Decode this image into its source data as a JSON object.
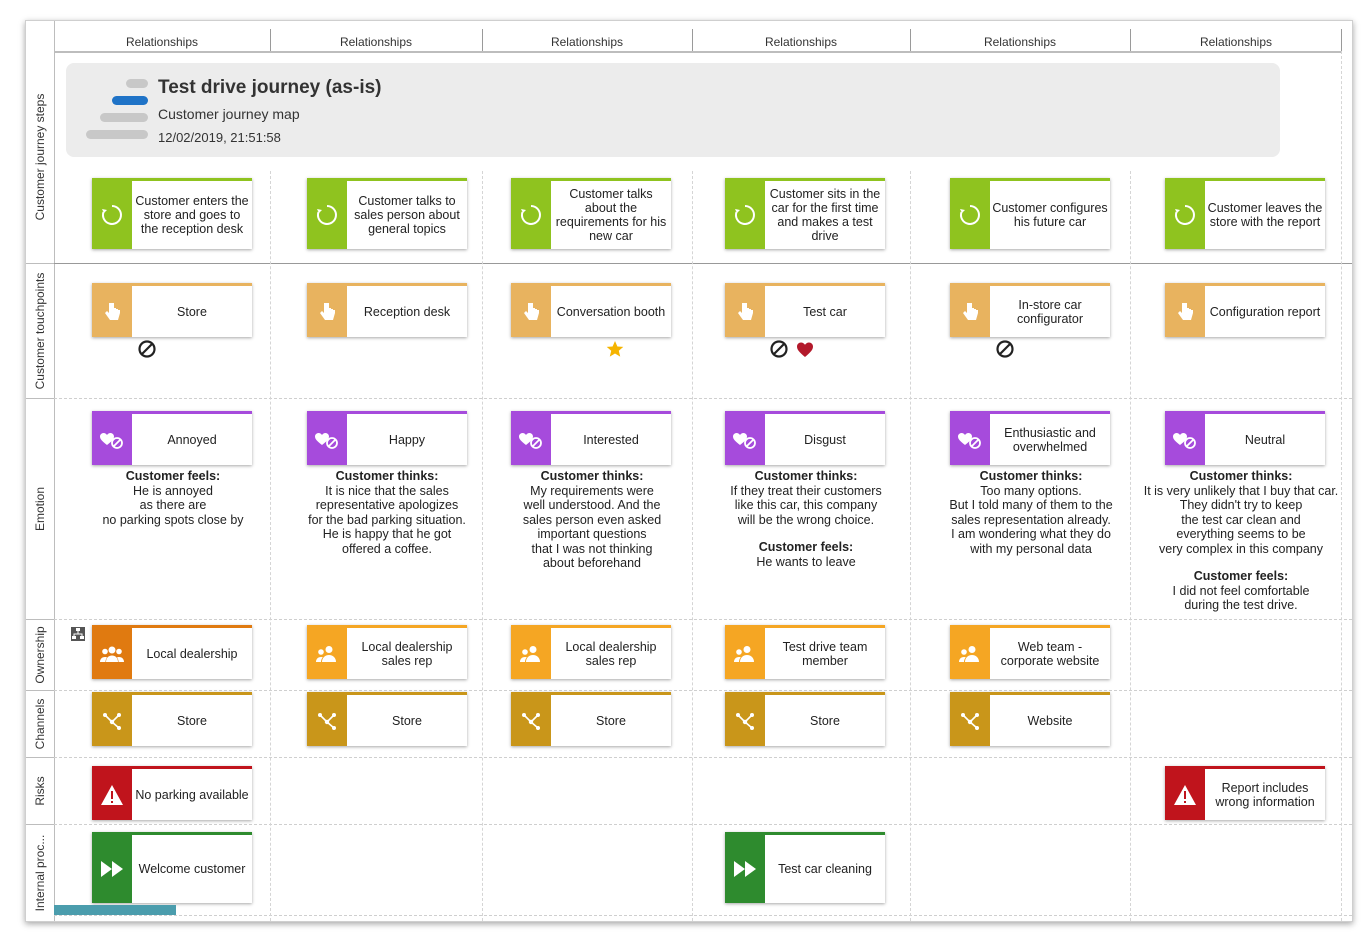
{
  "columns": [
    "Relationships",
    "Relationships",
    "Relationships",
    "Relationships",
    "Relationships",
    "Relationships"
  ],
  "rows": [
    "Customer journey steps",
    "Customer touchpoints",
    "Emotion",
    "Ownership",
    "Channels",
    "Risks",
    "Internal proc..."
  ],
  "header": {
    "title": "Test drive journey (as-is)",
    "subtitle": "Customer journey map",
    "date": "12/02/2019, 21:51:58"
  },
  "steps": [
    "Customer enters the store and goes to the reception desk",
    "Customer talks to sales person about general topics",
    "Customer talks about the requirements for his new car",
    "Customer sits in the car for the first time and makes a test drive",
    "Customer configures his future car",
    "Customer leaves the store with the report"
  ],
  "touchpoints": [
    "Store",
    "Reception desk",
    "Conversation booth",
    "Test car",
    "In-store car configurator",
    "Configuration report"
  ],
  "emotions": [
    "Annoyed",
    "Happy",
    "Interested",
    "Disgust",
    "Enthusiastic and overwhelmed",
    "Neutral"
  ],
  "emotion_texts": [
    [
      {
        "h": "Customer feels:",
        "t": [
          "He is annoyed",
          "as there are",
          "no parking spots close by"
        ]
      }
    ],
    [
      {
        "h": "Customer thinks:",
        "t": [
          "It is nice that the sales",
          "representative apologizes",
          "for the bad parking situation.",
          "He is happy that he got",
          "offered a coffee."
        ]
      }
    ],
    [
      {
        "h": "Customer thinks:",
        "t": [
          "My requirements were",
          "well understood. And the",
          "sales person even asked",
          "important questions",
          "that I was not thinking",
          "about beforehand"
        ]
      }
    ],
    [
      {
        "h": "Customer thinks:",
        "t": [
          "If they treat their customers",
          "like this car, this company",
          "will be the wrong choice."
        ]
      },
      {
        "h": "Customer feels:",
        "t": [
          "He wants to leave"
        ]
      }
    ],
    [
      {
        "h": "Customer thinks:",
        "t": [
          "Too many options.",
          "But I told many of them to the",
          "sales representation already.",
          "I am wondering what they do",
          "with my personal data"
        ]
      }
    ],
    [
      {
        "h": "Customer thinks:",
        "t": [
          "It is very unlikely that I buy that car.",
          "They didn't try to keep",
          "the test car clean and",
          "everything seems to be",
          "very complex in this company"
        ]
      },
      {
        "h": "Customer feels:",
        "t": [
          "I did not feel comfortable",
          "during the test drive."
        ]
      }
    ]
  ],
  "ownership": [
    "Local dealership",
    "Local dealership sales rep",
    "Local dealership sales rep",
    "Test drive team member",
    "Web team - corporate website"
  ],
  "channels": [
    "Store",
    "Store",
    "Store",
    "Store",
    "Website"
  ],
  "risks": {
    "col0": "No parking available",
    "col5": "Report includes wrong information"
  },
  "processes": {
    "col0": "Welcome customer",
    "col3": "Test car cleaning"
  },
  "colors": {
    "step": "#8fc31f",
    "touchpoint": "#e8b35f",
    "emotion": "#a64bdc",
    "ownership_dark": "#e07a10",
    "ownership": "#f5a623",
    "channel": "#c9961a",
    "risk": "#c0141c",
    "process": "#2e8b2e"
  }
}
